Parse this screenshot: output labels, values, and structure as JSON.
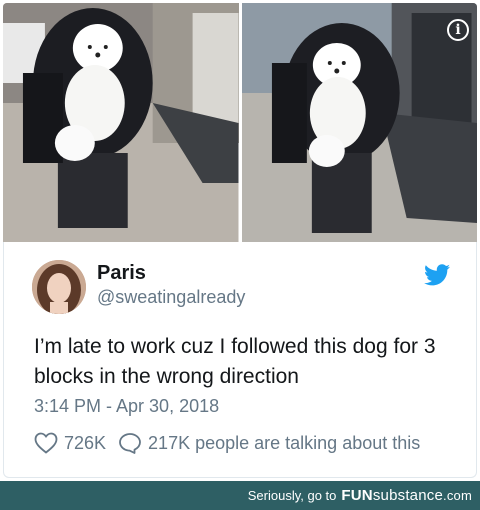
{
  "tweet": {
    "name": "Paris",
    "handle": "@sweatingalready",
    "text": "I’m late to work cuz I followed this dog for 3 blocks in the wrong direction",
    "timestamp": "3:14 PM - Apr 30, 2018",
    "likes": "726K",
    "talking": "217K people are talking about this",
    "like_icon": "heart-icon",
    "reply_icon": "speech-bubble-icon",
    "brand_icon": "twitter-bird-icon",
    "brand_color": "#1da1f2"
  },
  "media": {
    "info_glyph": "i",
    "info_icon": "info-icon"
  },
  "footer": {
    "lead": "Seriously, go to",
    "brand_bold": "FUN",
    "brand_rest": "substance",
    "brand_suffix": ".com",
    "background": "#2e5f64"
  }
}
